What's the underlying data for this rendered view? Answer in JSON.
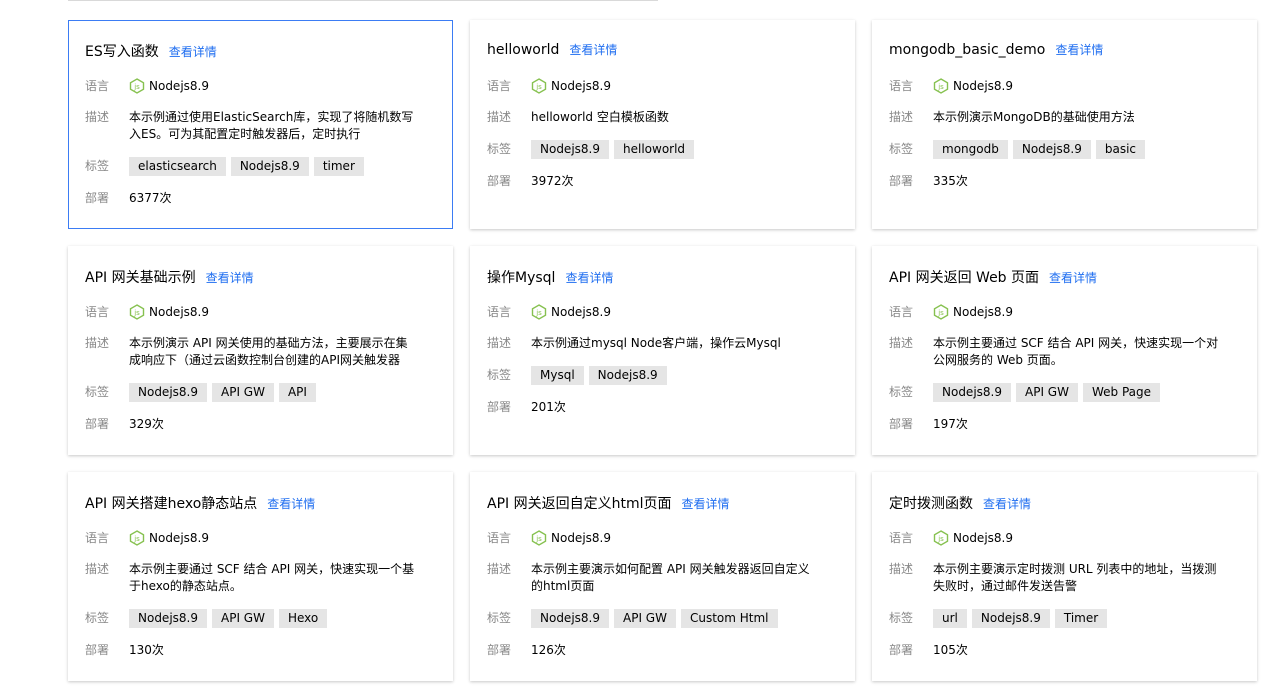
{
  "labels": {
    "language": "语言",
    "description": "描述",
    "tags": "标签",
    "deploy": "部署",
    "detail_link": "查看详情"
  },
  "colors": {
    "link": "#1f6ef0",
    "active_border": "#3b7cf4",
    "tag_bg": "#e5e5e5",
    "label": "#888888",
    "node_icon": "#86c14f"
  },
  "cards": [
    {
      "title": "ES写入函数",
      "language": "Nodejs8.9",
      "description": "本示例通过使用ElasticSearch库，实现了将随机数写入ES。可为其配置定时触发器后，定时执行",
      "tags": [
        "elasticsearch",
        "Nodejs8.9",
        "timer"
      ],
      "deploy": "6377次",
      "active": true
    },
    {
      "title": "helloworld",
      "language": "Nodejs8.9",
      "description": "helloworld 空白模板函数",
      "tags": [
        "Nodejs8.9",
        "helloworld"
      ],
      "deploy": "3972次"
    },
    {
      "title": "mongodb_basic_demo",
      "language": "Nodejs8.9",
      "description": "本示例演示MongoDB的基础使用方法",
      "tags": [
        "mongodb",
        "Nodejs8.9",
        "basic"
      ],
      "deploy": "335次"
    },
    {
      "title": "API 网关基础示例",
      "language": "Nodejs8.9",
      "description": "本示例演示 API 网关使用的基础方法，主要展示在集成响应下（通过云函数控制台创建的API网关触发器默…",
      "tags": [
        "Nodejs8.9",
        "API GW",
        "API"
      ],
      "deploy": "329次"
    },
    {
      "title": "操作Mysql",
      "language": "Nodejs8.9",
      "description": "本示例通过mysql Node客户端，操作云Mysql",
      "tags": [
        "Mysql",
        "Nodejs8.9"
      ],
      "deploy": "201次"
    },
    {
      "title": "API 网关返回 Web 页面",
      "language": "Nodejs8.9",
      "description": "本示例主要通过 SCF 结合 API 网关，快速实现一个对公网服务的 Web 页面。",
      "tags": [
        "Nodejs8.9",
        "API GW",
        "Web Page"
      ],
      "deploy": "197次"
    },
    {
      "title": "API 网关搭建hexo静态站点",
      "language": "Nodejs8.9",
      "description": "本示例主要通过 SCF 结合 API 网关，快速实现一个基于hexo的静态站点。",
      "tags": [
        "Nodejs8.9",
        "API GW",
        "Hexo"
      ],
      "deploy": "130次"
    },
    {
      "title": "API 网关返回自定义html页面",
      "language": "Nodejs8.9",
      "description": "本示例主要演示如何配置 API 网关触发器返回自定义的html页面",
      "tags": [
        "Nodejs8.9",
        "API GW",
        "Custom Html"
      ],
      "deploy": "126次"
    },
    {
      "title": "定时拨测函数",
      "language": "Nodejs8.9",
      "description": "本示例主要演示定时拨测 URL 列表中的地址，当拨测失败时，通过邮件发送告警",
      "tags": [
        "url",
        "Nodejs8.9",
        "Timer"
      ],
      "deploy": "105次"
    }
  ]
}
